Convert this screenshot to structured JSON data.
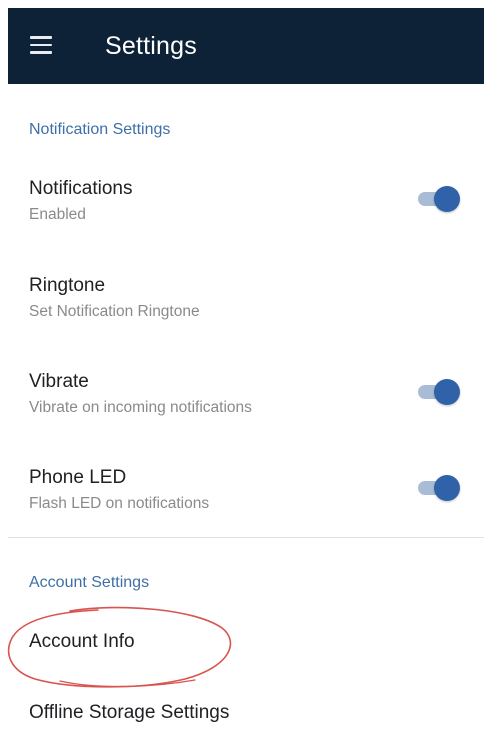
{
  "app_bar": {
    "title": "Settings",
    "menu_icon": "hamburger-menu-icon",
    "background_color": "#0d2137"
  },
  "sections": {
    "notification": {
      "header": "Notification Settings",
      "items": [
        {
          "title": "Notifications",
          "summary": "Enabled",
          "switch_on": true
        },
        {
          "title": "Ringtone",
          "summary": "Set Notification Ringtone"
        },
        {
          "title": "Vibrate",
          "summary": "Vibrate on incoming notifications",
          "switch_on": true
        },
        {
          "title": "Phone LED",
          "summary": "Flash LED on notifications",
          "switch_on": true
        }
      ]
    },
    "account": {
      "header": "Account Settings",
      "items": [
        {
          "title": "Account Info"
        },
        {
          "title": "Offline Storage Settings"
        }
      ]
    }
  },
  "colors": {
    "accent": "#3f6fa8",
    "switch_thumb": "#2f62a8",
    "switch_track": "#a9bcd6",
    "annotation_circle": "#d9534f"
  }
}
